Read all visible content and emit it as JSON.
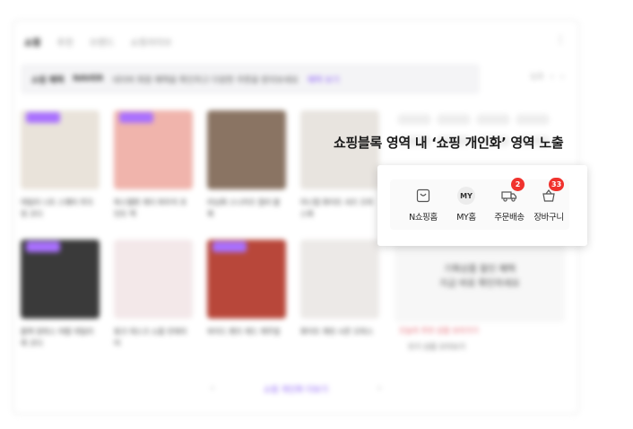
{
  "background": {
    "tabs": [
      "쇼핑",
      "추천",
      "브랜드",
      "쇼핑라이브"
    ],
    "notice": {
      "strong": "쇼핑 혜택",
      "brand": "NAVER",
      "text": "네이버 회원 혜택을 확인하고 다양한 쿠폰을 받아보세요",
      "link": "혜택 보기"
    },
    "pager": {
      "page": "1/3",
      "prev": "‹",
      "next": "›"
    },
    "products_row1": [
      {
        "caption": "데일리 니트 스웨터 루즈핏 코디",
        "badge": true,
        "color": "#e9e3da"
      },
      {
        "caption": "파스텔톤 레더 파우치 포인트 백",
        "badge": true,
        "color": "#f0b4ac"
      },
      {
        "caption": "러닝화 스니커즈 컬러 블록",
        "badge": false,
        "color": "#8a7463"
      },
      {
        "caption": "미니멀 화이트 셔츠 오피스룩",
        "badge": false,
        "color": "#e8e4df"
      }
    ],
    "products_row2": [
      {
        "caption": "블랙 원피스 여름 데일리룩 코디",
        "badge": true,
        "color": "#3a3a3a"
      },
      {
        "caption": "핑크 데스크 소품 인테리어",
        "badge": false,
        "color": "#f3e8e9"
      },
      {
        "caption": "와이드 팬츠 레드 캐주얼",
        "badge": true,
        "color": "#b8473a"
      },
      {
        "caption": "화이트 재킷 시즌 오피스",
        "badge": false,
        "color": "#ece9e7"
      }
    ],
    "promo": {
      "line1": "기획상품 할인 혜택",
      "line2": "지금 바로 확인하세요",
      "link": "오늘의 추천 상품 보러가기",
      "sub": "인기 상품 모아보기"
    },
    "footer": {
      "prev": "‹",
      "label": "쇼핑 개인화 더보기",
      "next": "›"
    }
  },
  "overlay": {
    "headline": "쇼핑블록 영역 내 ‘쇼핑 개인화’ 영역 노출",
    "items": [
      {
        "label": "N쇼핑홈",
        "icon": "shopping-home-icon",
        "badge": null
      },
      {
        "label": "MY홈",
        "icon_text": "MY",
        "badge": null
      },
      {
        "label": "주문배송",
        "icon": "delivery-truck-icon",
        "badge": "2"
      },
      {
        "label": "장바구니",
        "icon": "shopping-basket-icon",
        "badge": "33"
      }
    ],
    "badge_color": "#f0322d"
  }
}
